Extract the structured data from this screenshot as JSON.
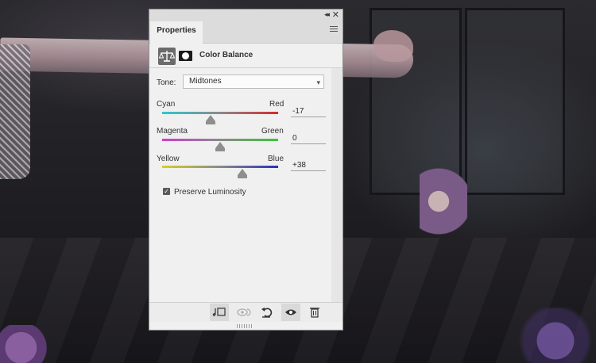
{
  "panel": {
    "tab_label": "Properties",
    "title": "Color Balance",
    "collapse_icon": "double-chevron-left-icon",
    "close_icon": "close-icon",
    "menu_icon": "panel-menu-icon"
  },
  "tone": {
    "label": "Tone:",
    "value": "Midtones"
  },
  "sliders": [
    {
      "left_label": "Cyan",
      "right_label": "Red",
      "value": "-17",
      "level": -17,
      "colors": [
        "#29c9d2",
        "#d8272c"
      ]
    },
    {
      "left_label": "Magenta",
      "right_label": "Green",
      "value": "0",
      "level": 0,
      "colors": [
        "#cf3bd2",
        "#3cc33a"
      ]
    },
    {
      "left_label": "Yellow",
      "right_label": "Blue",
      "value": "+38",
      "level": 38,
      "colors": [
        "#d7d21f",
        "#2931c0"
      ]
    }
  ],
  "preserve_luminosity": {
    "label": "Preserve Luminosity",
    "checked": true
  },
  "bottom_toolbar": [
    {
      "icon": "clip-to-layer-icon",
      "active": true
    },
    {
      "icon": "view-previous-state-icon",
      "active": false
    },
    {
      "icon": "reset-icon",
      "active": false
    },
    {
      "icon": "toggle-visibility-icon",
      "active": true
    },
    {
      "icon": "delete-icon",
      "active": false
    }
  ]
}
